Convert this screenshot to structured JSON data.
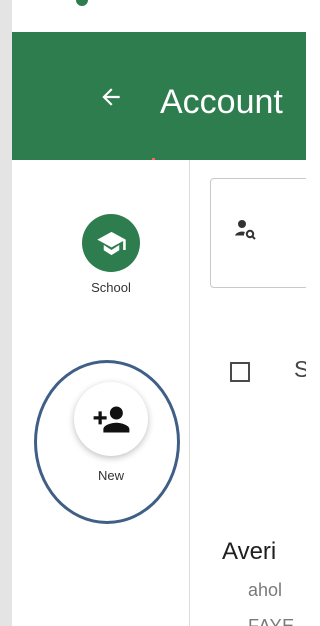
{
  "header": {
    "title": "Account",
    "back_icon": "arrow-left-icon",
    "background": "#2e7d4f"
  },
  "sidebar": {
    "items": [
      {
        "label": "School",
        "icon": "school-icon"
      },
      {
        "label": "New",
        "icon": "add-person-icon"
      }
    ]
  },
  "search": {
    "icon": "search-person-icon"
  },
  "list": {
    "select_all_label": "S",
    "items": [
      {
        "name": "Averi",
        "email": "ahol",
        "tag": "FAYE"
      }
    ]
  },
  "colors": {
    "accent": "#2e7d4f",
    "annotation": "#3f5f87"
  }
}
